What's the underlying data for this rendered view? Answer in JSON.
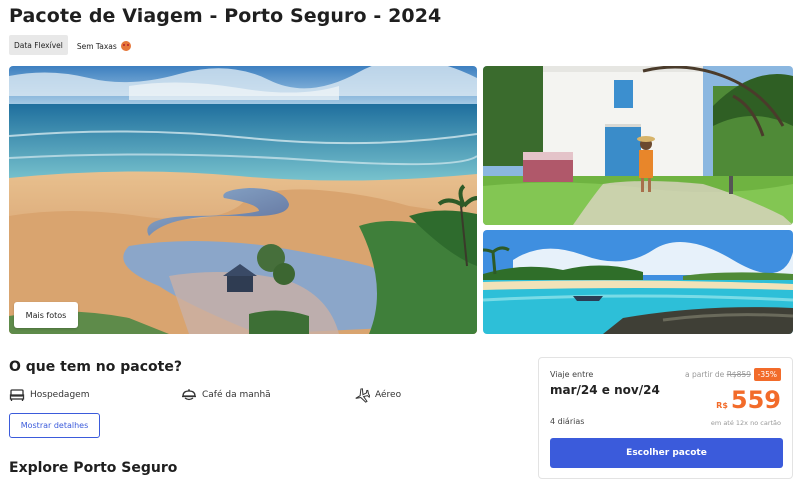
{
  "header": {
    "title": "Pacote de Viagem - Porto Seguro - 2024"
  },
  "tags": [
    {
      "label": "Data Flexível",
      "active": true
    },
    {
      "label": "Sem Taxas",
      "icon": "smiling-emoji-icon",
      "active": false
    }
  ],
  "gallery": {
    "more_photos_label": "Mais fotos"
  },
  "package": {
    "heading": "O que tem no pacote?",
    "amenities": [
      {
        "label": "Hospedagem",
        "icon": "bed-icon"
      },
      {
        "label": "Café da manhã",
        "icon": "breakfast-icon"
      },
      {
        "label": "Aéreo",
        "icon": "airplane-icon"
      }
    ],
    "details_button": "Mostrar detalhes"
  },
  "explore": {
    "heading": "Explore Porto Seguro"
  },
  "pricing": {
    "travel_label": "Viaje entre",
    "dates": "mar/24 e nov/24",
    "from_prefix": "a partir de",
    "old_price": "R$859",
    "discount": "-35%",
    "currency": "R$",
    "price": "559",
    "nights": "4 diárias",
    "installments": "em até 12x no cartão",
    "cta": "Escolher pacote",
    "accent_color": "#f26b2a",
    "primary_color": "#3b5bdb"
  }
}
